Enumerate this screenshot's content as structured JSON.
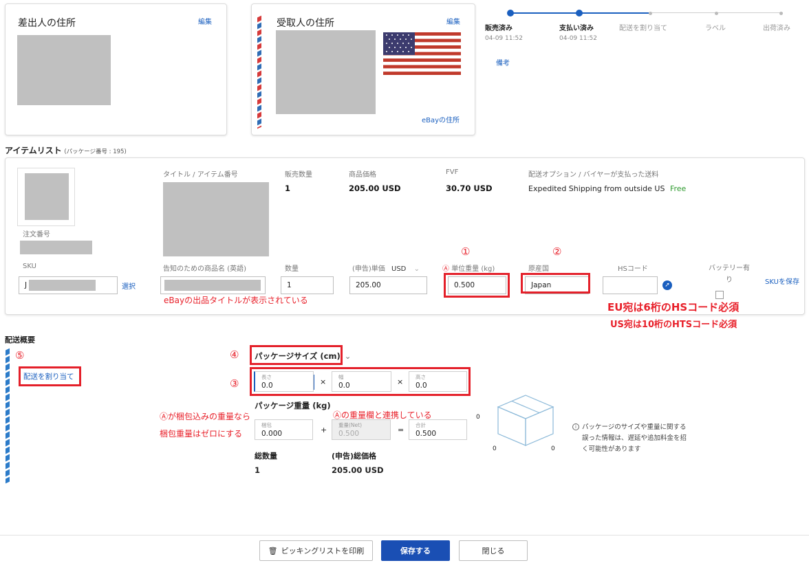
{
  "sender": {
    "title": "差出人の住所",
    "edit": "編集"
  },
  "receiver": {
    "title": "受取人の住所",
    "edit": "編集",
    "ebay_address": "eBayの住所"
  },
  "progress": {
    "steps": [
      {
        "label": "販売済み",
        "time": "04-09 11:52",
        "done": true
      },
      {
        "label": "支払い済み",
        "time": "04-09 11:52",
        "done": true
      },
      {
        "label": "配送を割り当て",
        "time": "",
        "done": false
      },
      {
        "label": "ラベル",
        "time": "",
        "done": false
      },
      {
        "label": "出荷済み",
        "time": "",
        "done": false
      }
    ],
    "note": "備考"
  },
  "items": {
    "heading": "アイテムリスト",
    "package_no": "(パッケージ番号 : 195)",
    "order_label": "注文番号",
    "headers": {
      "title": "タイトル / アイテム番号",
      "qty_sold": "販売数量",
      "price": "商品価格",
      "fvf": "FVF",
      "shipping": "配送オプション / バイヤーが支払った送料"
    },
    "values": {
      "qty_sold": "1",
      "price": "205.00 USD",
      "fvf": "30.70 USD",
      "shipping": "Expedited Shipping from outside US",
      "shipping_fee": "Free"
    },
    "fields": {
      "sku_label": "SKU",
      "sku_value": "J",
      "select": "選択",
      "customs_name_label": "告知のための商品名 (英語)",
      "qty_label": "数量",
      "qty_value": "1",
      "unit_price_label": "(申告)単価",
      "currency": "USD",
      "unit_price_value": "205.00",
      "weight_prefix": "Ⓐ",
      "weight_label": "単位重量 (kg)",
      "weight_value": "0.500",
      "origin_label": "原産国",
      "origin_value": "Japan",
      "hs_label": "HSコード",
      "battery_label": "バッテリー有り",
      "save_sku": "SKUを保存"
    }
  },
  "annotations": {
    "n1": "①",
    "n2": "②",
    "n3": "③",
    "n4": "④",
    "n5": "⑤",
    "title_shown": "eBayの出品タイトルが表示されている",
    "eu_hs": "EU宛は6桁のHSコード必須",
    "us_hts": "US宛は10桁のHTSコード必須",
    "packing_line1": "Ⓐが梱包込みの重量なら",
    "packing_line2": "梱包重量はゼロにする",
    "linked": "Ⓐの重量欄と連携している"
  },
  "shipping": {
    "heading": "配送概要",
    "assign": "配送を割り当て",
    "pkg_size_label": "パッケージサイズ (cm)",
    "length_label": "長さ",
    "length_value": "0.0",
    "width_label": "幅",
    "width_value": "0.0",
    "height_label": "高さ",
    "height_value": "0.0",
    "times": "×",
    "pkg_weight_label": "パッケージ重量 (kg)",
    "packing_label": "梱包",
    "packing_value": "0.000",
    "plus": "+",
    "net_label": "重量(Net)",
    "net_value": "0.500",
    "equals": "=",
    "total_label": "合計",
    "total_value": "0.500",
    "dim_top": "0",
    "dim_left": "0",
    "dim_right": "0",
    "total_qty_label": "総数量",
    "total_qty_value": "1",
    "total_value_label": "(申告)総価格",
    "total_value_value": "205.00 USD",
    "info_line1": "パッケージのサイズや重量に関する",
    "info_line2": "誤った情報は、遅延や追加料金を招",
    "info_line3": "く可能性があります"
  },
  "footer": {
    "print": "ピッキングリストを印刷",
    "save": "保存する",
    "close": "閉じる"
  },
  "colors": {
    "accent": "#1a5fbf",
    "primary_button": "#1a4fb4",
    "annotation_red": "#e4202a"
  }
}
